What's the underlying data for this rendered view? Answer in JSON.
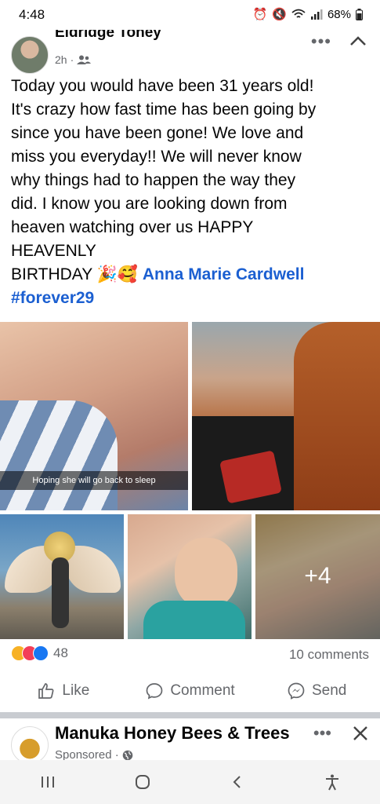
{
  "status_bar": {
    "time": "4:48",
    "battery": "68%"
  },
  "post": {
    "author": "Eldridge Toney",
    "time": "2h",
    "text_lines": [
      "Today you would have been 31 years old!",
      "It's crazy how fast time has been going by",
      "since you have been gone! We love and",
      "miss you everyday!! We will never know",
      "why things had to happen the way they",
      "did. I know you are looking down from",
      "heaven watching over us HAPPY",
      "HEAVENLY"
    ],
    "text_last_prefix": "BIRTHDAY",
    "emoji": "🎉🥰",
    "mention": "Anna Marie Cardwell",
    "hashtag": "#forever29",
    "photo_caption": "Hoping she will go back to sleep",
    "more_photos": "+4",
    "reaction_count": "48",
    "comments": "10 comments",
    "like": "Like",
    "comment": "Comment",
    "send": "Send"
  },
  "ad": {
    "name": "Manuka Honey Bees & Trees",
    "meta": "Sponsored ·"
  },
  "icons": [
    "group-icon",
    "more-icon",
    "collapse-icon",
    "like-icon",
    "comment-icon",
    "messenger-icon",
    "globe-icon",
    "close-icon",
    "recents-icon",
    "home-icon",
    "back-icon",
    "accessibility-icon"
  ],
  "colors": {
    "link": "#1b5fd1",
    "secondary_text": "#65676b",
    "reaction_care": "#f7b125",
    "reaction_love": "#f33e58",
    "reaction_like": "#1877f2"
  }
}
